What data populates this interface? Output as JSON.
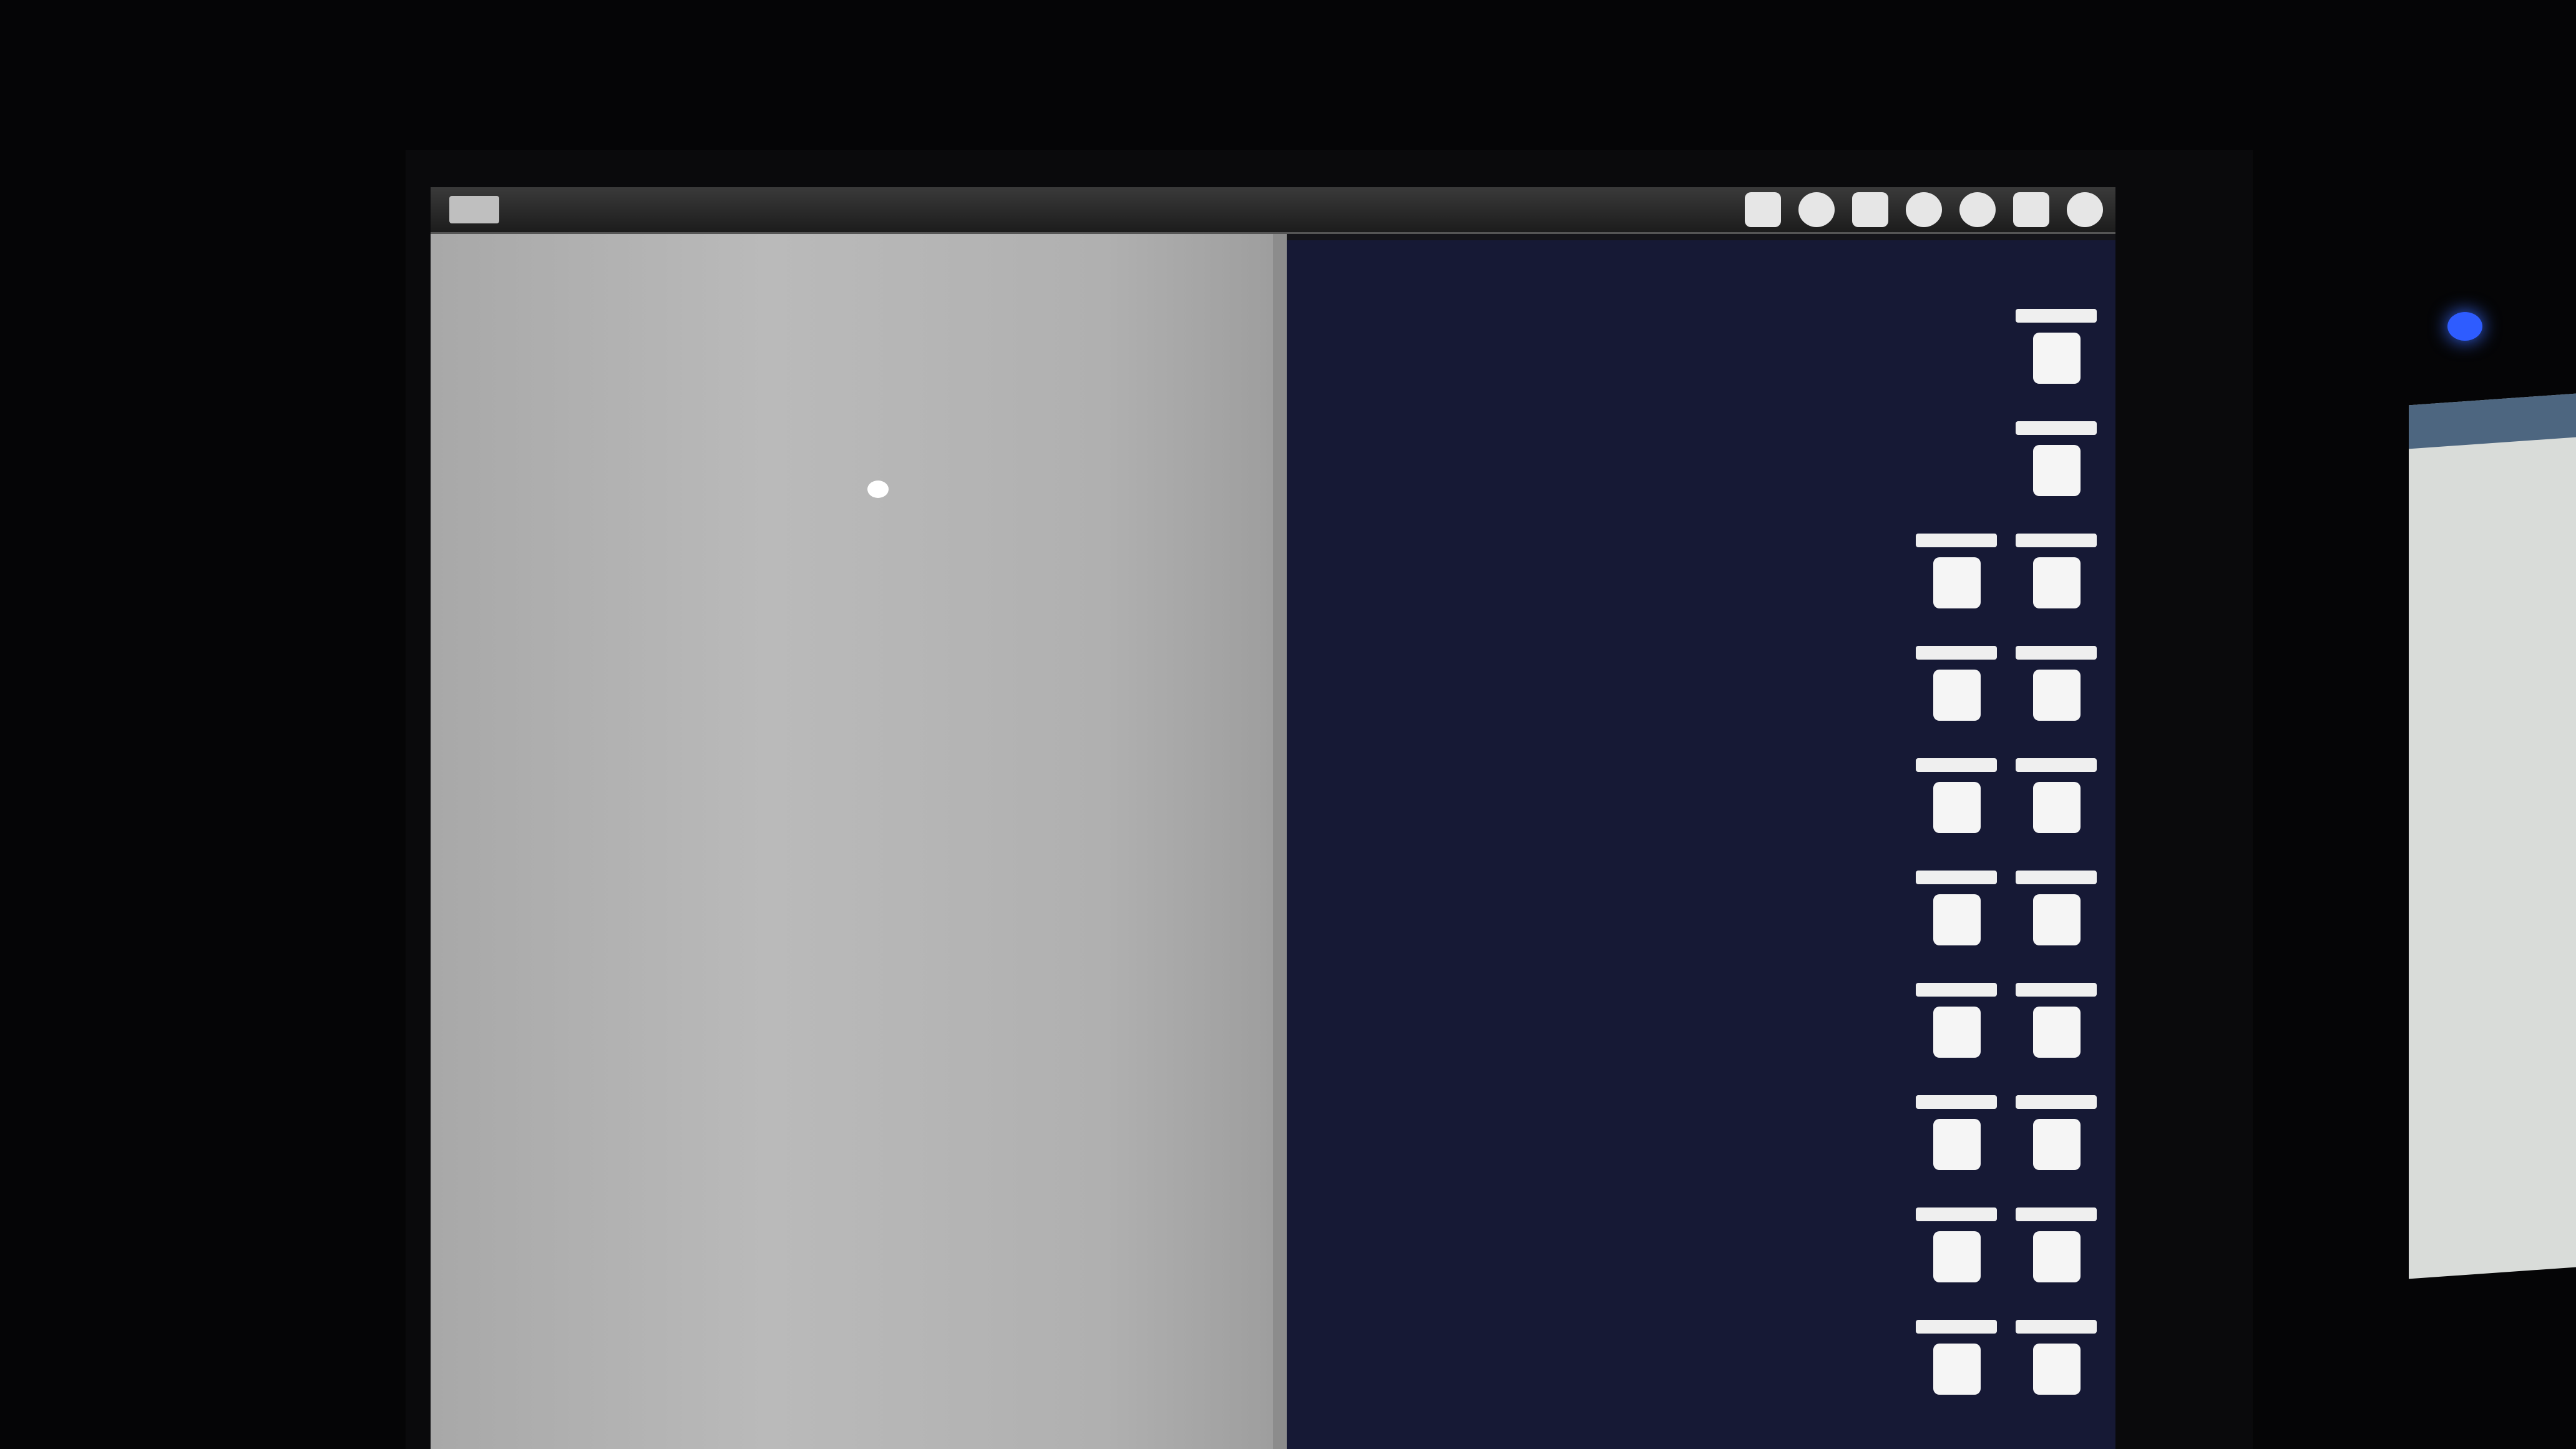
{
  "menubar": {
    "title": ""
  },
  "desktop": {
    "icons": [
      {
        "column": "right",
        "row": 0
      },
      {
        "column": "right",
        "row": 1
      },
      {
        "column": "left",
        "row": 2
      },
      {
        "column": "right",
        "row": 2
      },
      {
        "column": "left",
        "row": 3
      },
      {
        "column": "right",
        "row": 3
      },
      {
        "column": "left",
        "row": 4
      },
      {
        "column": "right",
        "row": 4
      },
      {
        "column": "left",
        "row": 5
      },
      {
        "column": "right",
        "row": 5
      },
      {
        "column": "left",
        "row": 6
      },
      {
        "column": "right",
        "row": 6
      },
      {
        "column": "left",
        "row": 7
      },
      {
        "column": "right",
        "row": 7
      },
      {
        "column": "left",
        "row": 8
      },
      {
        "column": "right",
        "row": 8
      },
      {
        "column": "left",
        "row": 9
      },
      {
        "column": "right",
        "row": 9
      }
    ]
  },
  "status_icons": [
    "window-icon",
    "search-icon",
    "display-icon",
    "wifi-icon",
    "clock-icon",
    "battery-icon",
    "notification-icon"
  ],
  "colors": {
    "desktop": "#161935",
    "left_pane": "#b0b0b0",
    "power_led": "#2e5cff"
  }
}
